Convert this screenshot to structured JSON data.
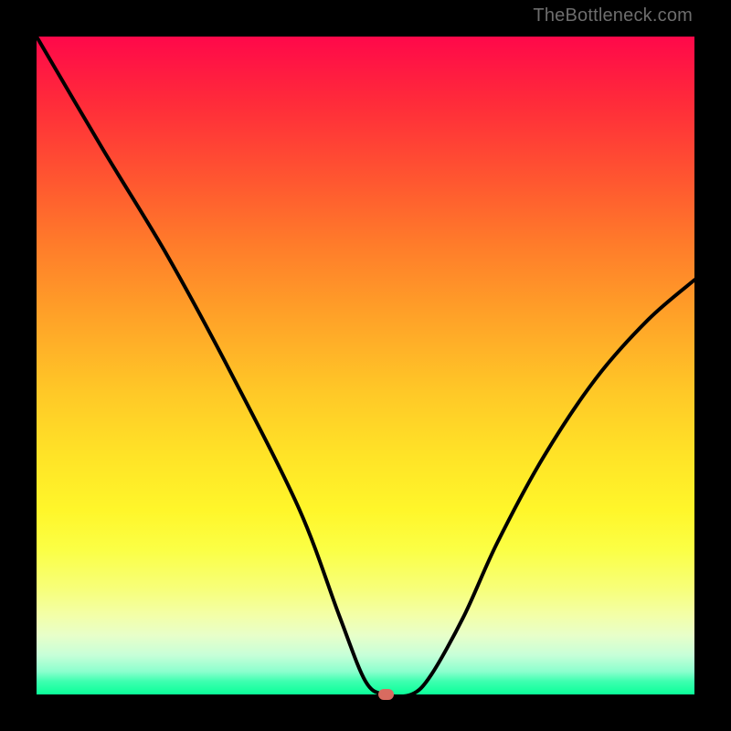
{
  "watermark": "TheBottleneck.com",
  "chart_data": {
    "type": "line",
    "title": "",
    "xlabel": "",
    "ylabel": "",
    "xlim": [
      0,
      100
    ],
    "ylim": [
      0,
      100
    ],
    "grid": false,
    "legend": false,
    "background": "rainbow-gradient-red-to-green",
    "series": [
      {
        "name": "bottleneck-curve",
        "x": [
          0,
          10,
          20,
          30,
          40,
          46,
          50,
          53,
          57,
          60,
          65,
          70,
          77,
          85,
          93,
          100
        ],
        "values": [
          100,
          83,
          66.5,
          48,
          28,
          12,
          2,
          0,
          0,
          3,
          12,
          23,
          36,
          48,
          57,
          63
        ]
      }
    ],
    "marker": {
      "x": 53,
      "y": 0,
      "color": "#d86b60"
    }
  },
  "colors": {
    "frame": "#000000",
    "curve": "#000000",
    "marker": "#d86b60"
  }
}
